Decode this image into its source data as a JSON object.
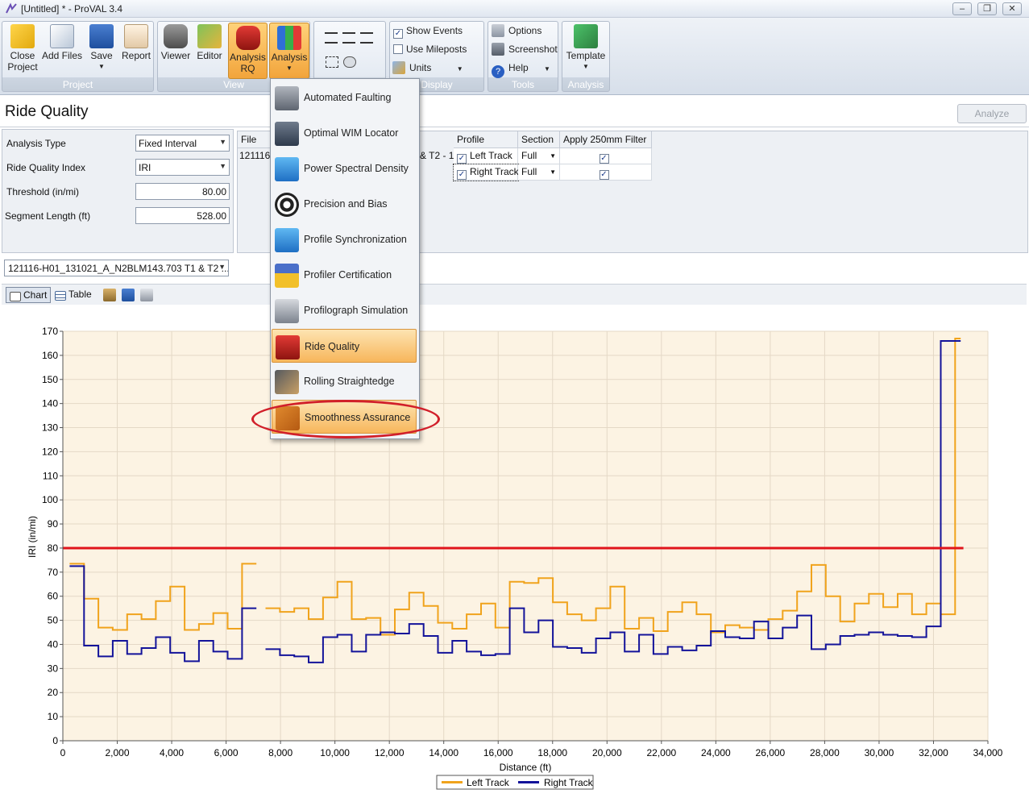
{
  "window": {
    "title": "[Untitled] * - ProVAL 3.4",
    "controls": [
      "–",
      "❐",
      "✕"
    ]
  },
  "ribbon": {
    "groups": {
      "project": "Project",
      "view": "View",
      "display": "Display",
      "tools": "Tools",
      "analysis": "Analysis"
    },
    "buttons": {
      "close_project": "Close\nProject",
      "add_files": "Add Files",
      "save": "Save",
      "report": "Report",
      "viewer": "Viewer",
      "editor": "Editor",
      "analysis_rq": "Analysis\nRQ",
      "analysis": "Analysis",
      "template": "Template"
    },
    "display": {
      "show_events": "Show Events",
      "use_mileposts": "Use Mileposts",
      "units": "Units"
    },
    "tools": {
      "options": "Options",
      "screenshot": "Screenshot",
      "help": "Help"
    }
  },
  "header": {
    "title": "Ride Quality",
    "analyze_label": "Analyze"
  },
  "settings": {
    "analysis_type_label": "Analysis Type",
    "analysis_type_value": "Fixed Interval",
    "index_label": "Ride Quality Index",
    "index_value": "IRI",
    "threshold_label": "Threshold (in/mi)",
    "threshold_value": "80.00",
    "segment_label": "Segment Length (ft)",
    "segment_value": "528.00"
  },
  "grid": {
    "headers": {
      "file": "File",
      "profile": "Profile",
      "section": "Section",
      "filter": "Apply 250mm Filter"
    },
    "file_partial": "121116",
    "file_suffix": "& T2 - 1",
    "rows": [
      {
        "profile": "Left Track",
        "section": "Full"
      },
      {
        "profile": "Right Track",
        "section": "Full"
      }
    ]
  },
  "file_select": "121116-H01_131021_A_N2BLM143.703 T1 & T2 ...",
  "toolbar": {
    "chart": "Chart",
    "table": "Table"
  },
  "menu": {
    "items": [
      {
        "label": "Automated Faulting",
        "icon": "faulting-icon"
      },
      {
        "label": "Optimal WIM Locator",
        "icon": "owl-icon"
      },
      {
        "label": "Power Spectral Density",
        "icon": "psd-icon"
      },
      {
        "label": "Precision and Bias",
        "icon": "target-icon"
      },
      {
        "label": "Profile Synchronization",
        "icon": "sync-icon"
      },
      {
        "label": "Profiler Certification",
        "icon": "medal-icon"
      },
      {
        "label": "Profilograph Simulation",
        "icon": "profilograph-icon"
      },
      {
        "label": "Ride Quality",
        "icon": "car-icon"
      },
      {
        "label": "Rolling Straightedge",
        "icon": "straightedge-icon"
      },
      {
        "label": "Smoothness Assurance",
        "icon": "puzzle-icon"
      }
    ],
    "highlighted": [
      "Ride Quality",
      "Smoothness Assurance"
    ]
  },
  "colors": {
    "left_track": "#f0a31c",
    "right_track": "#13139a",
    "threshold": "#e0141b",
    "plot_bg": "#fcf3e3",
    "highlight": "#f7b65b",
    "ellipse": "#d11f2a"
  },
  "chart_data": {
    "type": "line",
    "xlabel": "Distance (ft)",
    "ylabel": "IRI (in/mi)",
    "xlim": [
      0,
      34000
    ],
    "ylim": [
      0,
      170
    ],
    "xticks": [
      0,
      2000,
      4000,
      6000,
      8000,
      10000,
      12000,
      14000,
      16000,
      18000,
      20000,
      22000,
      24000,
      26000,
      28000,
      30000,
      32000,
      34000
    ],
    "xtick_labels": [
      "0",
      "2,000",
      "4,000",
      "6,000",
      "8,000",
      "10,000",
      "12,000",
      "14,000",
      "16,000",
      "18,000",
      "20,000",
      "22,000",
      "24,000",
      "26,000",
      "28,000",
      "30,000",
      "32,000",
      "34,000"
    ],
    "yticks": [
      0,
      10,
      20,
      30,
      40,
      50,
      60,
      70,
      80,
      90,
      100,
      110,
      120,
      130,
      140,
      150,
      160,
      170
    ],
    "grid": true,
    "legend": "bottom-center",
    "threshold": 80,
    "series": [
      {
        "name": "Left Track",
        "segments": [
          {
            "start": 250,
            "values": [
              73.5,
              59,
              47,
              46,
              52.5,
              50.5,
              58,
              64,
              46,
              48.5,
              53,
              46.5,
              73.5
            ]
          },
          {
            "start": 7450,
            "values": [
              55,
              53.5,
              55,
              50.5,
              59.5,
              66,
              50.5,
              51,
              44,
              54.5,
              61.5,
              56,
              49,
              46.5,
              52.5,
              57,
              47,
              66,
              65.5,
              67.5,
              57.5,
              52.5,
              50,
              55,
              64,
              46.5,
              51,
              45.5,
              53.5,
              57.5,
              52.5,
              45,
              48,
              47,
              46,
              50.5,
              54,
              62,
              73,
              60,
              49.5,
              57,
              61,
              55.5,
              61,
              52.5,
              57,
              52.5
            ]
          }
        ],
        "last_point": {
          "x": 33000,
          "y": 167
        }
      },
      {
        "name": "Right Track",
        "segments": [
          {
            "start": 250,
            "values": [
              72.5,
              39.5,
              35,
              41.5,
              36,
              38.5,
              43,
              36.5,
              33,
              41.5,
              37,
              34,
              55
            ]
          },
          {
            "start": 7450,
            "values": [
              38,
              35.5,
              35,
              32.5,
              43,
              44,
              37,
              44,
              45,
              44.5,
              48.5,
              43.5,
              36.5,
              41.5,
              37,
              35.5,
              36,
              55,
              45,
              50,
              39,
              38.5,
              36.5,
              42.5,
              45,
              37,
              44,
              36,
              39,
              37.5,
              39.5,
              45.5,
              43,
              42.5,
              49.5,
              42.5,
              47,
              52,
              38,
              40,
              43.5,
              44,
              45,
              44,
              43.5,
              43,
              47.5
            ]
          }
        ],
        "last_point": {
          "x": 33000,
          "y": 166
        }
      }
    ]
  }
}
